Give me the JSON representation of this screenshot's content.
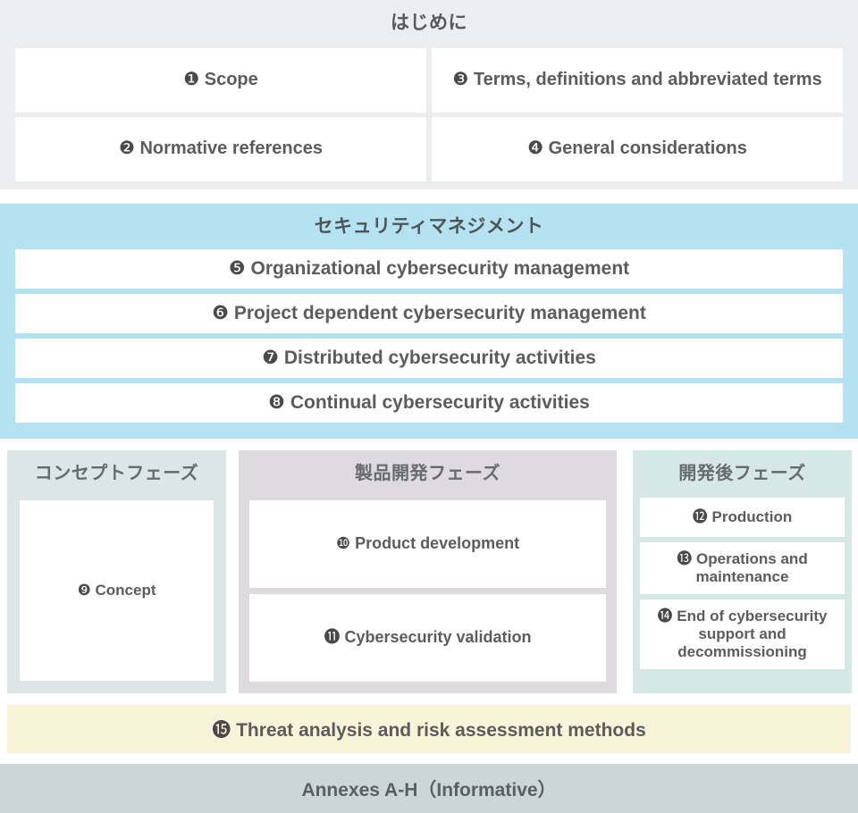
{
  "diagram": {
    "title_visible": false,
    "colors": {
      "intro_bg": "#ecedef",
      "security_bg": "#b5e2f0",
      "concept_phase_bg": "#dde6e6",
      "development_phase_bg": "#dfdade",
      "post_development_phase_bg": "#d6e8e5",
      "tara_bg": "#f8f4d9",
      "annexes_bg": "#ccd6d7",
      "box_bg": "#ffffff",
      "text": "#5c5c5c"
    }
  },
  "intro": {
    "heading": "はじめに",
    "items": [
      {
        "num": "❶",
        "label": "Scope"
      },
      {
        "num": "❸",
        "label": "Terms, definitions and abbreviated terms"
      },
      {
        "num": "❷",
        "label": "Normative references"
      },
      {
        "num": "❹",
        "label": "General considerations"
      }
    ]
  },
  "security_management": {
    "heading": "セキュリティマネジメント",
    "items": [
      {
        "num": "❺",
        "label": "Organizational cybersecurity management"
      },
      {
        "num": "❻",
        "label": "Project dependent cybersecurity management"
      },
      {
        "num": "❼",
        "label": "Distributed cybersecurity activities"
      },
      {
        "num": "❽",
        "label": "Continual cybersecurity activities"
      }
    ]
  },
  "phases": {
    "concept": {
      "heading": "コンセプトフェーズ",
      "items": [
        {
          "num": "❾",
          "label": "Concept"
        }
      ]
    },
    "development": {
      "heading": "製品開発フェーズ",
      "items": [
        {
          "num": "❿",
          "label": "Product development"
        },
        {
          "num": "⓫",
          "label": "Cybersecurity validation"
        }
      ]
    },
    "post_development": {
      "heading": "開発後フェーズ",
      "items": [
        {
          "num": "⓬",
          "label": "Production"
        },
        {
          "num": "⓭",
          "label": "Operations and maintenance"
        },
        {
          "num": "⓮",
          "label": "End of cybersecurity support and decommissioning"
        }
      ]
    }
  },
  "tara": {
    "num": "⓯",
    "label": "Threat analysis and risk assessment methods"
  },
  "annexes": {
    "label": "Annexes A-H（Informative）"
  }
}
